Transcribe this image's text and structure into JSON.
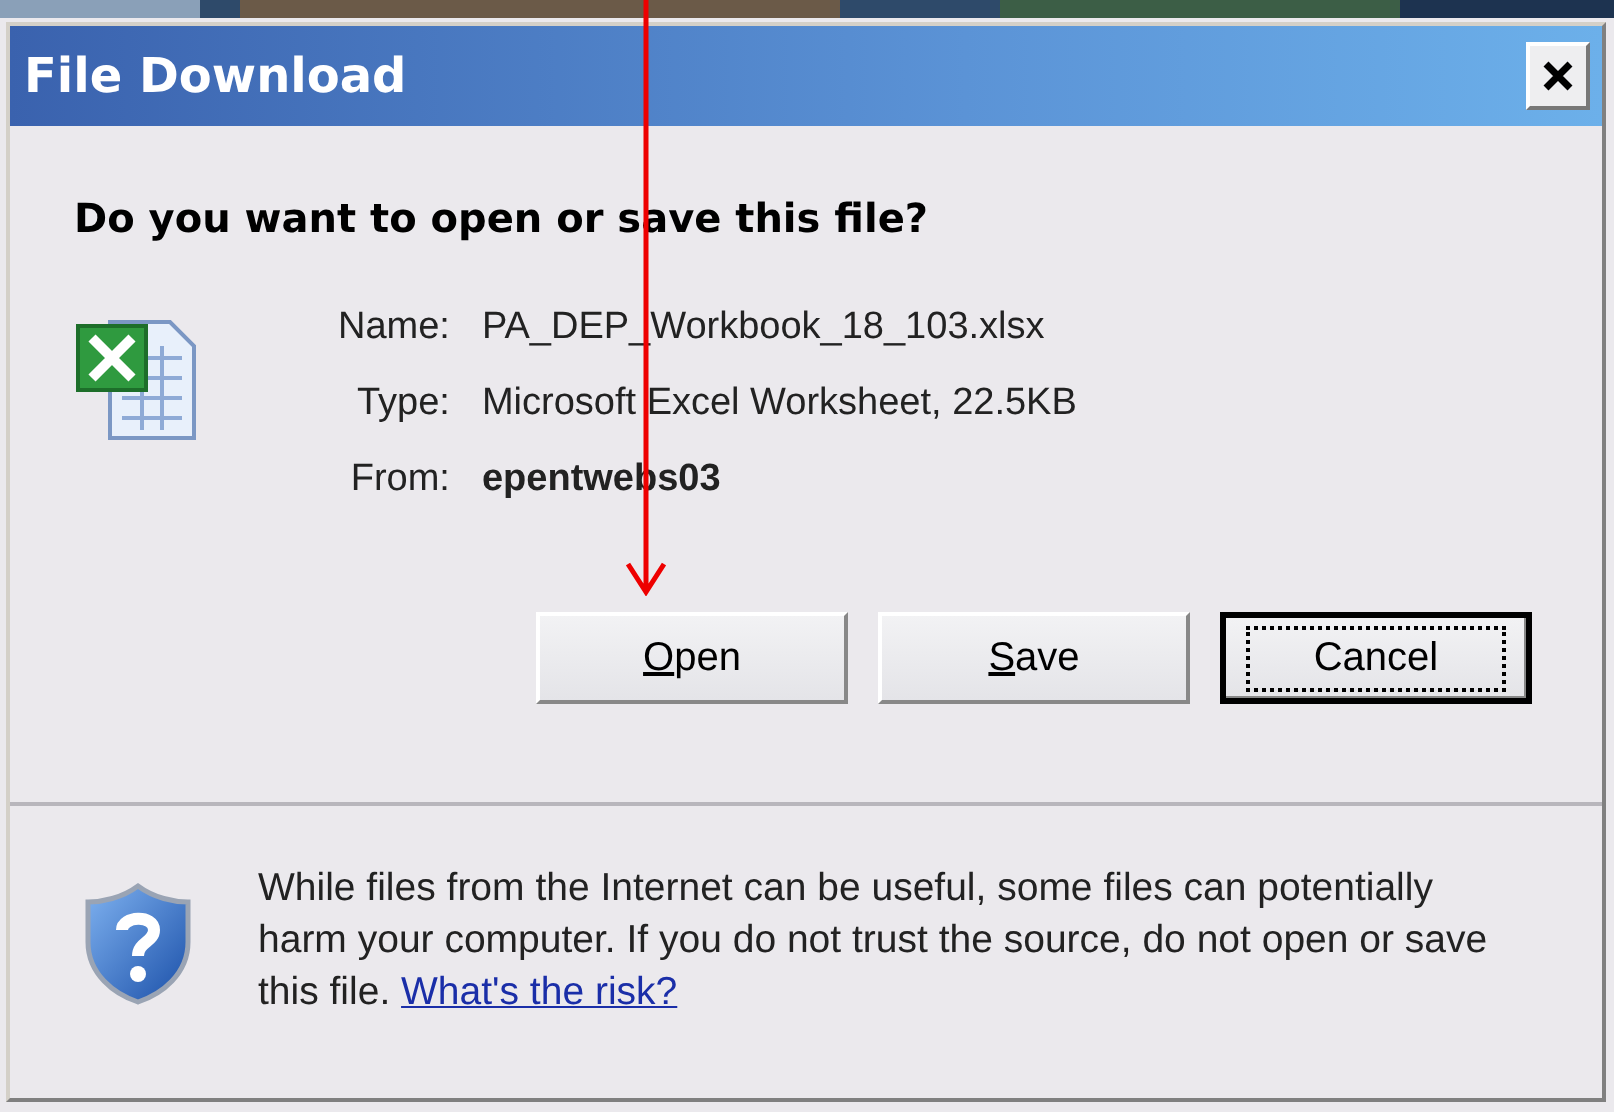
{
  "window": {
    "title": "File Download"
  },
  "question": "Do you want to open or save this file?",
  "file_info": [
    {
      "label": "Name:",
      "value": "PA_DEP_Workbook_18_103.xlsx",
      "bold": false
    },
    {
      "label": "Type:",
      "value": "Microsoft Excel Worksheet, 22.5KB",
      "bold": false
    },
    {
      "label": "From:",
      "value": "epentwebs03",
      "bold": true
    }
  ],
  "buttons": [
    {
      "access_key": "O",
      "rest": "pen",
      "focused": false
    },
    {
      "access_key": "S",
      "rest": "ave",
      "focused": false
    },
    {
      "rest": "Cancel",
      "focused": true
    }
  ],
  "warning": {
    "text": "While files from the Internet can be useful, some files can potentially harm your computer. If you do not trust the source, do not open or save this file.",
    "link": "What's the risk?"
  }
}
